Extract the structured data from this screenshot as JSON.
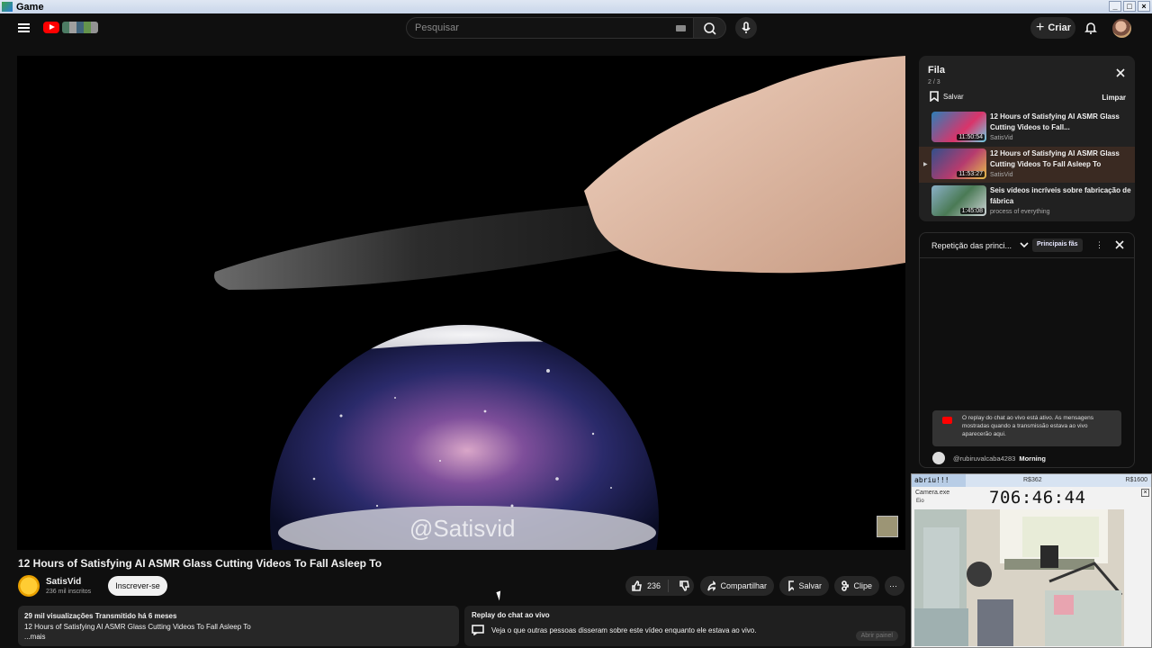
{
  "window": {
    "title": "Game"
  },
  "masthead": {
    "search_placeholder": "Pesquisar",
    "create_label": "Criar"
  },
  "video": {
    "watermark": "@Satisvid",
    "title": "12 Hours of Satisfying AI ASMR Glass Cutting Videos To Fall Asleep To",
    "channel_name": "SatisVid",
    "subscribers": "236 mil inscritos",
    "subscribe_label": "Inscrever-se",
    "likes": "236",
    "share_label": "Compartilhar",
    "save_label": "Salvar",
    "clip_label": "Clipe"
  },
  "description": {
    "stats": "29 mil visualizações  Transmitido há 6 meses",
    "text": "12 Hours of Satisfying AI ASMR Glass Cutting Videos To Fall Asleep To",
    "more": "...mais"
  },
  "chat_replay": {
    "heading": "Replay do chat ao vivo",
    "body": "Veja o que outras pessoas disseram sobre este vídeo enquanto ele estava ao vivo.",
    "open_label": "Abrir painel"
  },
  "queue": {
    "title": "Fila",
    "count": "2 / 3",
    "save_label": "Salvar",
    "clear_label": "Limpar",
    "items": [
      {
        "title": "12 Hours of Satisfying AI ASMR Glass Cutting Videos to Fall...",
        "channel": "SatisVid",
        "duration": "11:50:54"
      },
      {
        "title": "12 Hours of Satisfying AI ASMR Glass Cutting Videos To Fall Asleep To",
        "channel": "SatisVid",
        "duration": "11:53:27"
      },
      {
        "title": "Seis vídeos incríveis sobre fabricação de fábrica",
        "channel": "process of everything",
        "duration": "1:45:08"
      }
    ]
  },
  "chat_panel": {
    "label": "Repetição das princi...",
    "badge": "Principais fãs",
    "notice": "O replay do chat ao vivo está ativo. As mensagens mostradas quando a transmissão estava ao vivo aparecerão aqui.",
    "message_user": "@rubiruvalcaba4283",
    "message_text": "Morning"
  },
  "overlay": {
    "split_name": "abriu!!!",
    "split_mid": "R$362",
    "split_right": "R$1600",
    "app": "Camera.exe",
    "menu": "Eio",
    "timer": "706:46:44"
  },
  "colors": {
    "brand_red": "#ff0000",
    "background": "#0f0f0f",
    "active_queue": "#3a2a22"
  }
}
